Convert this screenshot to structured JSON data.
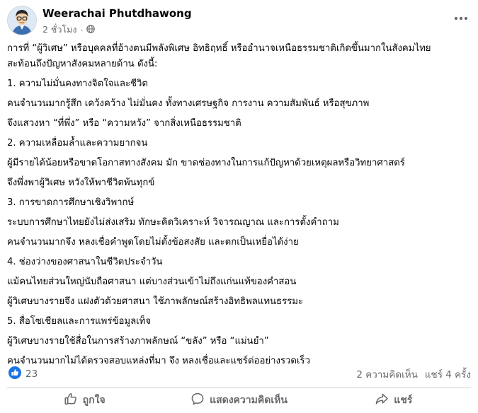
{
  "post": {
    "author": "Weerachai Phutdhawong",
    "time": "2 ชั่วโมง",
    "separator": "·",
    "paragraphs": [
      {
        "kind": "intro",
        "text": "การที่ “ผู้วิเศษ” หรือบุคคลที่อ้างตนมีพลังพิเศษ อิทธิฤทธิ์ หรืออำนาจเหนือธรรมชาติเกิดขึ้นมากในสังคมไทย"
      },
      {
        "kind": "intro",
        "text": "สะท้อนถึงปัญหาสังคมหลายด้าน ดังนี้:"
      },
      {
        "kind": "head",
        "text": "1. ความไม่มั่นคงทางจิตใจและชีวิต"
      },
      {
        "kind": "line",
        "text": "คนจำนวนมากรู้สึก เคว้งคว้าง ไม่มั่นคง ทั้งทางเศรษฐกิจ การงาน ความสัมพันธ์ หรือสุขภาพ"
      },
      {
        "kind": "line",
        "text": "จึงแสวงหา “ที่พึ่ง” หรือ “ความหวัง” จากสิ่งเหนือธรรมชาติ"
      },
      {
        "kind": "head",
        "text": "2. ความเหลื่อมล้ำและความยากจน"
      },
      {
        "kind": "line",
        "text": "ผู้มีรายได้น้อยหรือขาดโอกาสทางสังคม มัก ขาดช่องทางในการแก้ปัญหาด้วยเหตุผลหรือวิทยาศาสตร์"
      },
      {
        "kind": "line",
        "text": "จึงพึ่งพาผู้วิเศษ หวังให้พาชีวิตพ้นทุกข์"
      },
      {
        "kind": "head",
        "text": "3. การขาดการศึกษาเชิงวิพากษ์"
      },
      {
        "kind": "line",
        "text": "ระบบการศึกษาไทยยังไม่ส่งเสริม ทักษะคิดวิเคราะห์ วิจารณญาณ และการตั้งคำถาม"
      },
      {
        "kind": "line",
        "text": "คนจำนวนมากจึง หลงเชื่อคำพูดโดยไม่ตั้งข้อสงสัย และตกเป็นเหยื่อได้ง่าย"
      },
      {
        "kind": "head",
        "text": "4. ช่องว่างของศาสนาในชีวิตประจำวัน"
      },
      {
        "kind": "line",
        "text": "แม้คนไทยส่วนใหญ่นับถือศาสนา แต่บางส่วนเข้าไม่ถึงแก่นแท้ของคำสอน"
      },
      {
        "kind": "line",
        "text": "ผู้วิเศษบางรายจึง แฝงตัวด้วยศาสนา ใช้ภาพลักษณ์สร้างอิทธิพลแทนธรรมะ"
      },
      {
        "kind": "head",
        "text": "5. สื่อโซเชียลและการแพร่ข้อมูลเท็จ"
      },
      {
        "kind": "line",
        "text": "ผู้วิเศษบางรายใช้สื่อในการสร้างภาพลักษณ์ “ขลัง” หรือ “แม่นยำ”"
      },
      {
        "kind": "line",
        "text": "คนจำนวนมากไม่ได้ตรวจสอบแหล่งที่มา จึง หลงเชื่อและแชร์ต่ออย่างรวดเร็ว"
      }
    ]
  },
  "stats": {
    "reaction_count": "23",
    "comments": "2 ความคิดเห็น",
    "shares": "แชร์ 4 ครั้ง"
  },
  "actions": {
    "like": "ถูกใจ",
    "comment": "แสดงความคิดเห็น",
    "share": "แชร์"
  },
  "icons": {
    "globe": "globe-icon",
    "more": "more-dots-icon",
    "like_reaction": "like-reaction-icon",
    "like": "thumbs-up-icon",
    "comment": "comment-bubble-icon",
    "share": "share-arrow-icon"
  },
  "colors": {
    "text": "#050505",
    "secondary": "#65676b",
    "like_blue": "#1b74e4",
    "divider": "#ced0d4"
  }
}
